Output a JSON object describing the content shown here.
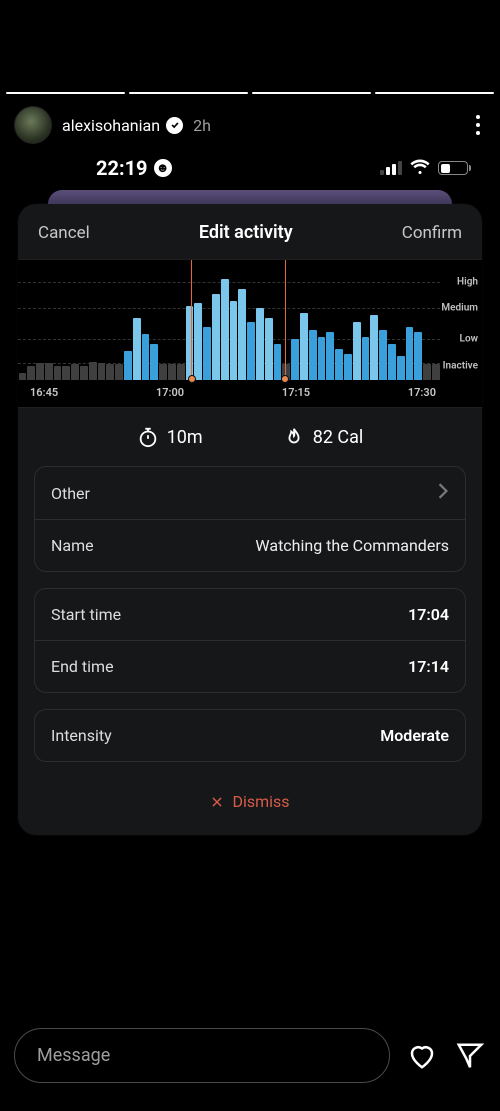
{
  "story": {
    "username": "alexisohanian",
    "time_ago": "2h",
    "message_placeholder": "Message"
  },
  "device": {
    "time": "22:19"
  },
  "panel": {
    "cancel": "Cancel",
    "title": "Edit activity",
    "confirm": "Confirm",
    "duration": "10m",
    "calories": "82 Cal",
    "dismiss": "Dismiss"
  },
  "rows": {
    "category_label": "Other",
    "name_label": "Name",
    "name_value": "Watching the Commanders",
    "start_label": "Start time",
    "start_value": "17:04",
    "end_label": "End time",
    "end_value": "17:14",
    "intensity_label": "Intensity",
    "intensity_value": "Moderate"
  },
  "chart_data": {
    "type": "bar",
    "xticks": [
      "16:45",
      "17:00",
      "17:15",
      "17:30"
    ],
    "ylevels": {
      "High": "High",
      "Medium": "Medium",
      "Low": "Low",
      "Inactive": "Inactive"
    },
    "selection": {
      "start": "17:04",
      "end": "17:14",
      "left_pct": 41,
      "right_pct": 63.5
    },
    "bars": [
      {
        "h": 6,
        "c": "gray"
      },
      {
        "h": 12,
        "c": "gray"
      },
      {
        "h": 14,
        "c": "gray"
      },
      {
        "h": 14,
        "c": "gray"
      },
      {
        "h": 12,
        "c": "gray"
      },
      {
        "h": 12,
        "c": "gray"
      },
      {
        "h": 13,
        "c": "gray"
      },
      {
        "h": 12,
        "c": "gray"
      },
      {
        "h": 15,
        "c": "gray"
      },
      {
        "h": 14,
        "c": "gray"
      },
      {
        "h": 13,
        "c": "gray"
      },
      {
        "h": 13,
        "c": "gray"
      },
      {
        "h": 24,
        "c": "blue"
      },
      {
        "h": 52,
        "c": "lblue"
      },
      {
        "h": 38,
        "c": "blue"
      },
      {
        "h": 30,
        "c": "blue"
      },
      {
        "h": 13,
        "c": "gray"
      },
      {
        "h": 13,
        "c": "gray"
      },
      {
        "h": 13,
        "c": "gray"
      },
      {
        "h": 62,
        "c": "lblue"
      },
      {
        "h": 64,
        "c": "lblue"
      },
      {
        "h": 44,
        "c": "blue"
      },
      {
        "h": 72,
        "c": "lblue"
      },
      {
        "h": 84,
        "c": "lblue"
      },
      {
        "h": 66,
        "c": "lblue"
      },
      {
        "h": 76,
        "c": "lblue"
      },
      {
        "h": 48,
        "c": "blue"
      },
      {
        "h": 60,
        "c": "lblue"
      },
      {
        "h": 52,
        "c": "lblue"
      },
      {
        "h": 30,
        "c": "blue"
      },
      {
        "h": 13,
        "c": "gray"
      },
      {
        "h": 34,
        "c": "blue"
      },
      {
        "h": 56,
        "c": "lblue"
      },
      {
        "h": 42,
        "c": "blue"
      },
      {
        "h": 36,
        "c": "blue"
      },
      {
        "h": 40,
        "c": "blue"
      },
      {
        "h": 26,
        "c": "blue"
      },
      {
        "h": 22,
        "c": "blue"
      },
      {
        "h": 48,
        "c": "lblue"
      },
      {
        "h": 36,
        "c": "blue"
      },
      {
        "h": 54,
        "c": "lblue"
      },
      {
        "h": 42,
        "c": "blue"
      },
      {
        "h": 30,
        "c": "blue"
      },
      {
        "h": 20,
        "c": "blue"
      },
      {
        "h": 44,
        "c": "blue"
      },
      {
        "h": 40,
        "c": "blue"
      },
      {
        "h": 13,
        "c": "gray"
      },
      {
        "h": 13,
        "c": "gray"
      }
    ]
  }
}
